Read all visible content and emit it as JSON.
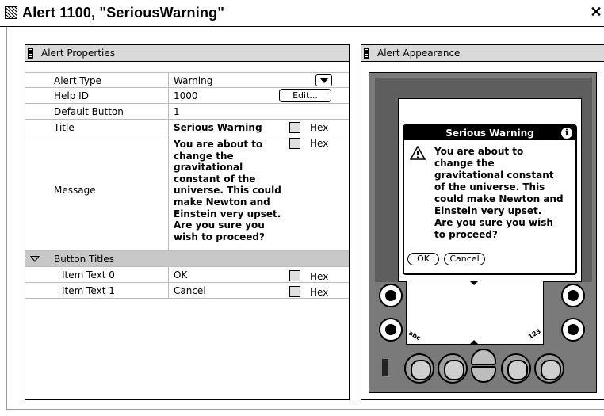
{
  "window": {
    "title": "Alert 1100, \"SeriousWarning\"",
    "close_label": "✕"
  },
  "properties_panel": {
    "title": "Alert Properties",
    "rows": {
      "alert_type": {
        "label": "Alert Type",
        "value": "Warning"
      },
      "help_id": {
        "label": "Help ID",
        "value": "1000",
        "button": "Edit..."
      },
      "default_button": {
        "label": "Default Button",
        "value": "1"
      },
      "title": {
        "label": "Title",
        "value": "Serious Warning",
        "hex": "Hex"
      },
      "message": {
        "label": "Message",
        "value": "You are about to\nchange the\ngravitational\nconstant of the\nuniverse.  This could\nmake Newton and\nEinstein very upset.\nAre you sure you\nwish to proceed?",
        "hex": "Hex"
      },
      "button_titles": {
        "label": "Button Titles"
      },
      "item_text_0": {
        "label": "Item Text 0",
        "value": "OK",
        "hex": "Hex"
      },
      "item_text_1": {
        "label": "Item Text 1",
        "value": "Cancel",
        "hex": "Hex"
      }
    }
  },
  "appearance_panel": {
    "title": "Alert Appearance",
    "alert": {
      "title": "Serious Warning",
      "info_glyph": "i",
      "message": "You are about to\nchange the\ngravitational constant\nof the universe.  This\ncould make Newton and\nEinstein very upset.\nAre you sure you wish\nto proceed?",
      "buttons": [
        "OK",
        "Cancel"
      ]
    },
    "graffiti": {
      "left_hint": "abc",
      "right_hint": "123"
    }
  },
  "colors": {
    "device_body": "#7a7a7a",
    "group_header": "#c8c8c8",
    "panel_header": "#d9d9d9"
  }
}
